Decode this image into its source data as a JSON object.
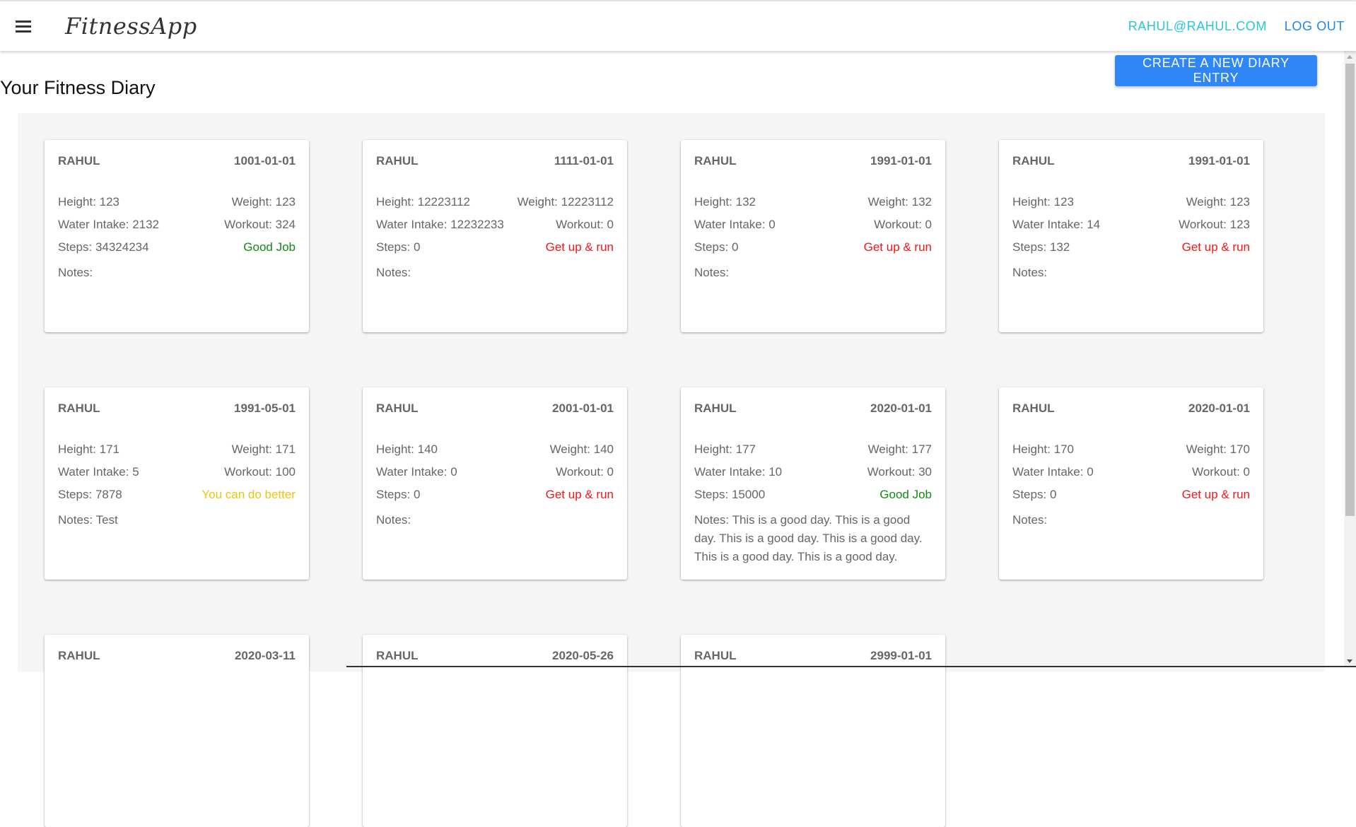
{
  "appbar": {
    "brand": "FitnessApp",
    "user_email": "RAHUL@RAHUL.COM",
    "logout_label": "LOG OUT"
  },
  "page": {
    "title": "Your Fitness Diary",
    "create_label": "CREATE A NEW DIARY ENTRY"
  },
  "labels": {
    "height": "Height:",
    "weight": "Weight:",
    "water": "Water Intake:",
    "workout": "Workout:",
    "steps": "Steps:",
    "notes": "Notes:"
  },
  "entries": [
    {
      "name": "RAHUL",
      "date": "1001-01-01",
      "height": "123",
      "weight": "123",
      "water": "2132",
      "workout": "324",
      "steps": "34324234",
      "status": "Good Job",
      "status_type": "good",
      "notes": ""
    },
    {
      "name": "RAHUL",
      "date": "1111-01-01",
      "height": "12223112",
      "weight": "12223112",
      "water": "12232233",
      "workout": "0",
      "steps": "0",
      "status": "Get up & run",
      "status_type": "bad",
      "notes": ""
    },
    {
      "name": "RAHUL",
      "date": "1991-01-01",
      "height": "132",
      "weight": "132",
      "water": "0",
      "workout": "0",
      "steps": "0",
      "status": "Get up & run",
      "status_type": "bad",
      "notes": ""
    },
    {
      "name": "RAHUL",
      "date": "1991-01-01",
      "height": "123",
      "weight": "123",
      "water": "14",
      "workout": "123",
      "steps": "132",
      "status": "Get up & run",
      "status_type": "bad",
      "notes": ""
    },
    {
      "name": "RAHUL",
      "date": "1991-05-01",
      "height": "171",
      "weight": "171",
      "water": "5",
      "workout": "100",
      "steps": "7878",
      "status": "You can do better",
      "status_type": "better",
      "notes": "Test"
    },
    {
      "name": "RAHUL",
      "date": "2001-01-01",
      "height": "140",
      "weight": "140",
      "water": "0",
      "workout": "0",
      "steps": "0",
      "status": "Get up & run",
      "status_type": "bad",
      "notes": ""
    },
    {
      "name": "RAHUL",
      "date": "2020-01-01",
      "height": "177",
      "weight": "177",
      "water": "10",
      "workout": "30",
      "steps": "15000",
      "status": "Good Job",
      "status_type": "good",
      "notes": "This is a good day. This is a good day. This is a good day. This is a good day. This is a good day. This is a good day."
    },
    {
      "name": "RAHUL",
      "date": "2020-01-01",
      "height": "170",
      "weight": "170",
      "water": "0",
      "workout": "0",
      "steps": "0",
      "status": "Get up & run",
      "status_type": "bad",
      "notes": ""
    },
    {
      "name": "RAHUL",
      "date": "2020-03-11"
    },
    {
      "name": "RAHUL",
      "date": "2020-05-26"
    },
    {
      "name": "RAHUL",
      "date": "2999-01-01"
    }
  ],
  "colors": {
    "primary_button": "#2f86f6",
    "email_link": "#26c6da",
    "logout_link": "#1e88e5",
    "good": "#128a12",
    "bad": "#f21616",
    "better": "#f4c20d"
  }
}
